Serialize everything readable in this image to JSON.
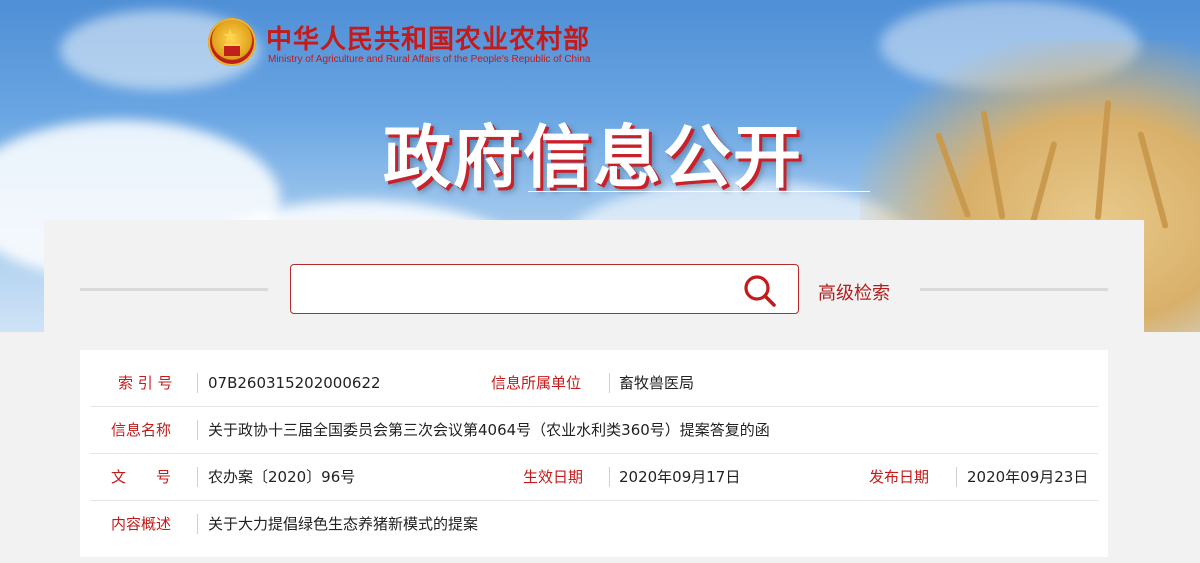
{
  "header": {
    "org_name_cn": "中华人民共和国农业农村部",
    "org_name_en": "Ministry of Agriculture and Rural Affairs of the People's Republic of China",
    "title": "政府信息公开"
  },
  "search": {
    "placeholder": "",
    "value": "",
    "advanced_label": "高级检索"
  },
  "info": {
    "index_label": "索 引 号",
    "index_value": "07B260315202000622",
    "unit_label": "信息所属单位",
    "unit_value": "畜牧兽医局",
    "name_label": "信息名称",
    "name_value": "关于政协十三届全国委员会第三次会议第4064号（农业水利类360号）提案答复的函",
    "docno_label": "文　　号",
    "docno_value": "农办案〔2020〕96号",
    "effective_label": "生效日期",
    "effective_value": "2020年09月17日",
    "publish_label": "发布日期",
    "publish_value": "2020年09月23日",
    "summary_label": "内容概述",
    "summary_value": "关于大力提倡绿色生态养猪新模式的提案"
  },
  "colors": {
    "brand_red": "#c41a1a",
    "search_border": "#b52a2a",
    "sky_blue": "#6aa6e3"
  }
}
